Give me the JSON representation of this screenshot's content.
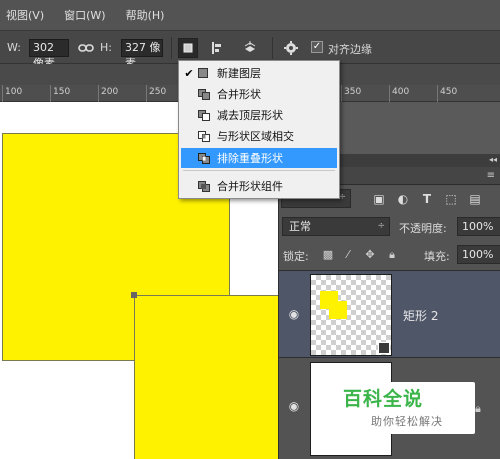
{
  "menubar": {
    "items": [
      "视图(V)",
      "窗口(W)",
      "帮助(H)"
    ]
  },
  "options_bar": {
    "width_label": "W:",
    "width_value": "302 像素",
    "height_label": "H:",
    "height_value": "327 像素",
    "align_edges_label": "对齐边缘",
    "align_edges_checked": true
  },
  "ruler": {
    "ticks": [
      "100",
      "150",
      "200",
      "250",
      "300",
      "350",
      "400",
      "450"
    ]
  },
  "dropdown": {
    "items": [
      {
        "label": "新建图层",
        "checked": true
      },
      {
        "label": "合并形状",
        "checked": false
      },
      {
        "label": "减去顶层形状",
        "checked": false
      },
      {
        "label": "与形状区域相交",
        "checked": false
      },
      {
        "label": "排除重叠形状",
        "checked": false,
        "highlighted": true
      },
      {
        "label": "合并形状组件",
        "checked": false
      }
    ]
  },
  "layers_panel": {
    "blend_mode": "正常",
    "opacity_label": "不透明度:",
    "opacity_value": "100%",
    "lock_label": "锁定:",
    "fill_label": "填充:",
    "fill_value": "100%",
    "layers": [
      {
        "name": "矩形 2",
        "selected": true
      },
      {
        "name": "",
        "selected": false
      }
    ]
  },
  "watermark": {
    "title": "百科全说",
    "subtitle": "助你轻松解决"
  },
  "colors": {
    "shape_fill": "#fff200",
    "highlight": "#3399ff",
    "selected_layer": "#4f5668"
  }
}
